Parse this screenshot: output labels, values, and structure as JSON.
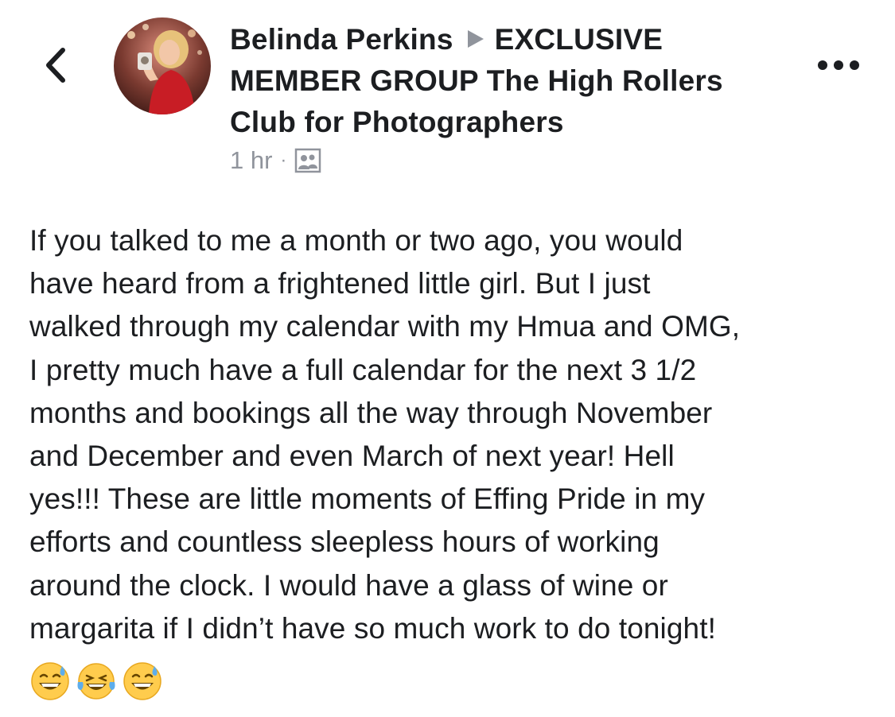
{
  "header": {
    "author": "Belinda Perkins",
    "group_line1": "EXCLUSIVE",
    "group_line2": "MEMBER GROUP The High Rollers",
    "group_line3": "Club for Photographers",
    "timestamp": "1 hr",
    "separator": "·",
    "privacy_icon": "group-members-icon"
  },
  "icons": {
    "back": "chevron-left-icon",
    "more": "more-horizontal-icon",
    "arrow": "triangle-right-icon"
  },
  "post": {
    "lines": [
      "If you talked to me a month or two ago, you would",
      "have heard from a frightened little girl.  But I just",
      "walked through my calendar with my Hmua and OMG,",
      "I pretty much have a full calendar for the next 3 1/2",
      "months and bookings all the way through November",
      "and December and even March of next year!  Hell",
      "yes!!!  These are little moments of Effing Pride in my",
      "efforts and countless sleepless hours of working",
      "around the clock.  I would have a glass of wine or",
      "margarita if I didn’t have so much work to do tonight!"
    ],
    "emojis": [
      "grinning-sweat-emoji",
      "tears-of-joy-emoji",
      "grinning-sweat-emoji"
    ]
  },
  "colors": {
    "text": "#1c1e21",
    "secondary": "#90949c",
    "emoji_yellow": "#ffcc4d"
  }
}
